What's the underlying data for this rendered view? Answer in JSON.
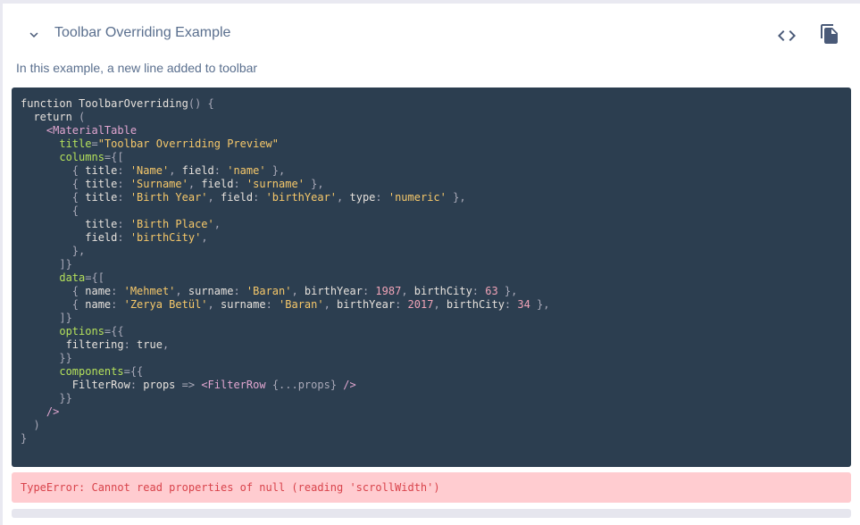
{
  "header": {
    "title": "Toolbar Overriding Example"
  },
  "description": "In this example, a new line added to toolbar",
  "icons": {
    "collapse": "chevron-down-icon",
    "code": "code-icon",
    "copy": "copy-icon"
  },
  "code_lines": [
    [
      [
        "kw",
        "function "
      ],
      [
        "prop",
        "ToolbarOverriding"
      ],
      [
        "punc",
        "() {"
      ]
    ],
    [
      [
        "kw",
        "  return "
      ],
      [
        "punc",
        "("
      ]
    ],
    [
      [
        "tag",
        "    <MaterialTable"
      ]
    ],
    [
      [
        "attr",
        "      title"
      ],
      [
        "punc",
        "="
      ],
      [
        "str",
        "\"Toolbar Overriding Preview\""
      ]
    ],
    [
      [
        "attr",
        "      columns"
      ],
      [
        "punc",
        "={["
      ]
    ],
    [
      [
        "punc",
        "        { "
      ],
      [
        "prop",
        "title"
      ],
      [
        "punc",
        ": "
      ],
      [
        "str",
        "'Name'"
      ],
      [
        "punc",
        ", "
      ],
      [
        "prop",
        "field"
      ],
      [
        "punc",
        ": "
      ],
      [
        "str",
        "'name'"
      ],
      [
        "punc",
        " },"
      ]
    ],
    [
      [
        "punc",
        "        { "
      ],
      [
        "prop",
        "title"
      ],
      [
        "punc",
        ": "
      ],
      [
        "str",
        "'Surname'"
      ],
      [
        "punc",
        ", "
      ],
      [
        "prop",
        "field"
      ],
      [
        "punc",
        ": "
      ],
      [
        "str",
        "'surname'"
      ],
      [
        "punc",
        " },"
      ]
    ],
    [
      [
        "punc",
        "        { "
      ],
      [
        "prop",
        "title"
      ],
      [
        "punc",
        ": "
      ],
      [
        "str",
        "'Birth Year'"
      ],
      [
        "punc",
        ", "
      ],
      [
        "prop",
        "field"
      ],
      [
        "punc",
        ": "
      ],
      [
        "str",
        "'birthYear'"
      ],
      [
        "punc",
        ", "
      ],
      [
        "prop",
        "type"
      ],
      [
        "punc",
        ": "
      ],
      [
        "str",
        "'numeric'"
      ],
      [
        "punc",
        " },"
      ]
    ],
    [
      [
        "punc",
        "        {"
      ]
    ],
    [
      [
        "prop",
        "          title"
      ],
      [
        "punc",
        ": "
      ],
      [
        "str",
        "'Birth Place'"
      ],
      [
        "punc",
        ","
      ]
    ],
    [
      [
        "prop",
        "          field"
      ],
      [
        "punc",
        ": "
      ],
      [
        "str",
        "'birthCity'"
      ],
      [
        "punc",
        ","
      ]
    ],
    [
      [
        "punc",
        "        },"
      ]
    ],
    [
      [
        "punc",
        "      ]}"
      ]
    ],
    [
      [
        "attr",
        "      data"
      ],
      [
        "punc",
        "={["
      ]
    ],
    [
      [
        "punc",
        "        { "
      ],
      [
        "prop",
        "name"
      ],
      [
        "punc",
        ": "
      ],
      [
        "str",
        "'Mehmet'"
      ],
      [
        "punc",
        ", "
      ],
      [
        "prop",
        "surname"
      ],
      [
        "punc",
        ": "
      ],
      [
        "str",
        "'Baran'"
      ],
      [
        "punc",
        ", "
      ],
      [
        "prop",
        "birthYear"
      ],
      [
        "punc",
        ": "
      ],
      [
        "num",
        "1987"
      ],
      [
        "punc",
        ", "
      ],
      [
        "prop",
        "birthCity"
      ],
      [
        "punc",
        ": "
      ],
      [
        "num",
        "63"
      ],
      [
        "punc",
        " },"
      ]
    ],
    [
      [
        "punc",
        "        { "
      ],
      [
        "prop",
        "name"
      ],
      [
        "punc",
        ": "
      ],
      [
        "str",
        "'Zerya Betül'"
      ],
      [
        "punc",
        ", "
      ],
      [
        "prop",
        "surname"
      ],
      [
        "punc",
        ": "
      ],
      [
        "str",
        "'Baran'"
      ],
      [
        "punc",
        ", "
      ],
      [
        "prop",
        "birthYear"
      ],
      [
        "punc",
        ": "
      ],
      [
        "num",
        "2017"
      ],
      [
        "punc",
        ", "
      ],
      [
        "prop",
        "birthCity"
      ],
      [
        "punc",
        ": "
      ],
      [
        "num",
        "34"
      ],
      [
        "punc",
        " },"
      ]
    ],
    [
      [
        "punc",
        "      ]}"
      ]
    ],
    [
      [
        "attr",
        "      options"
      ],
      [
        "punc",
        "={{"
      ]
    ],
    [
      [
        "prop",
        "       filtering"
      ],
      [
        "punc",
        ": "
      ],
      [
        "kw",
        "true"
      ],
      [
        "punc",
        ","
      ]
    ],
    [
      [
        "punc",
        "      }}"
      ]
    ],
    [
      [
        "attr",
        "      components"
      ],
      [
        "punc",
        "={{"
      ]
    ],
    [
      [
        "prop",
        "        FilterRow"
      ],
      [
        "punc",
        ": "
      ],
      [
        "prop",
        "props "
      ],
      [
        "punc",
        "=> "
      ],
      [
        "tag",
        "<FilterRow "
      ],
      [
        "punc",
        "{...props} "
      ],
      [
        "tag",
        "/>"
      ]
    ],
    [
      [
        "punc",
        "      }}"
      ]
    ],
    [
      [
        "tag",
        "    />"
      ]
    ],
    [
      [
        "punc",
        "  )"
      ]
    ],
    [
      [
        "punc",
        "}"
      ]
    ]
  ],
  "error": {
    "message": "TypeError: Cannot read properties of null (reading 'scrollWidth')"
  }
}
